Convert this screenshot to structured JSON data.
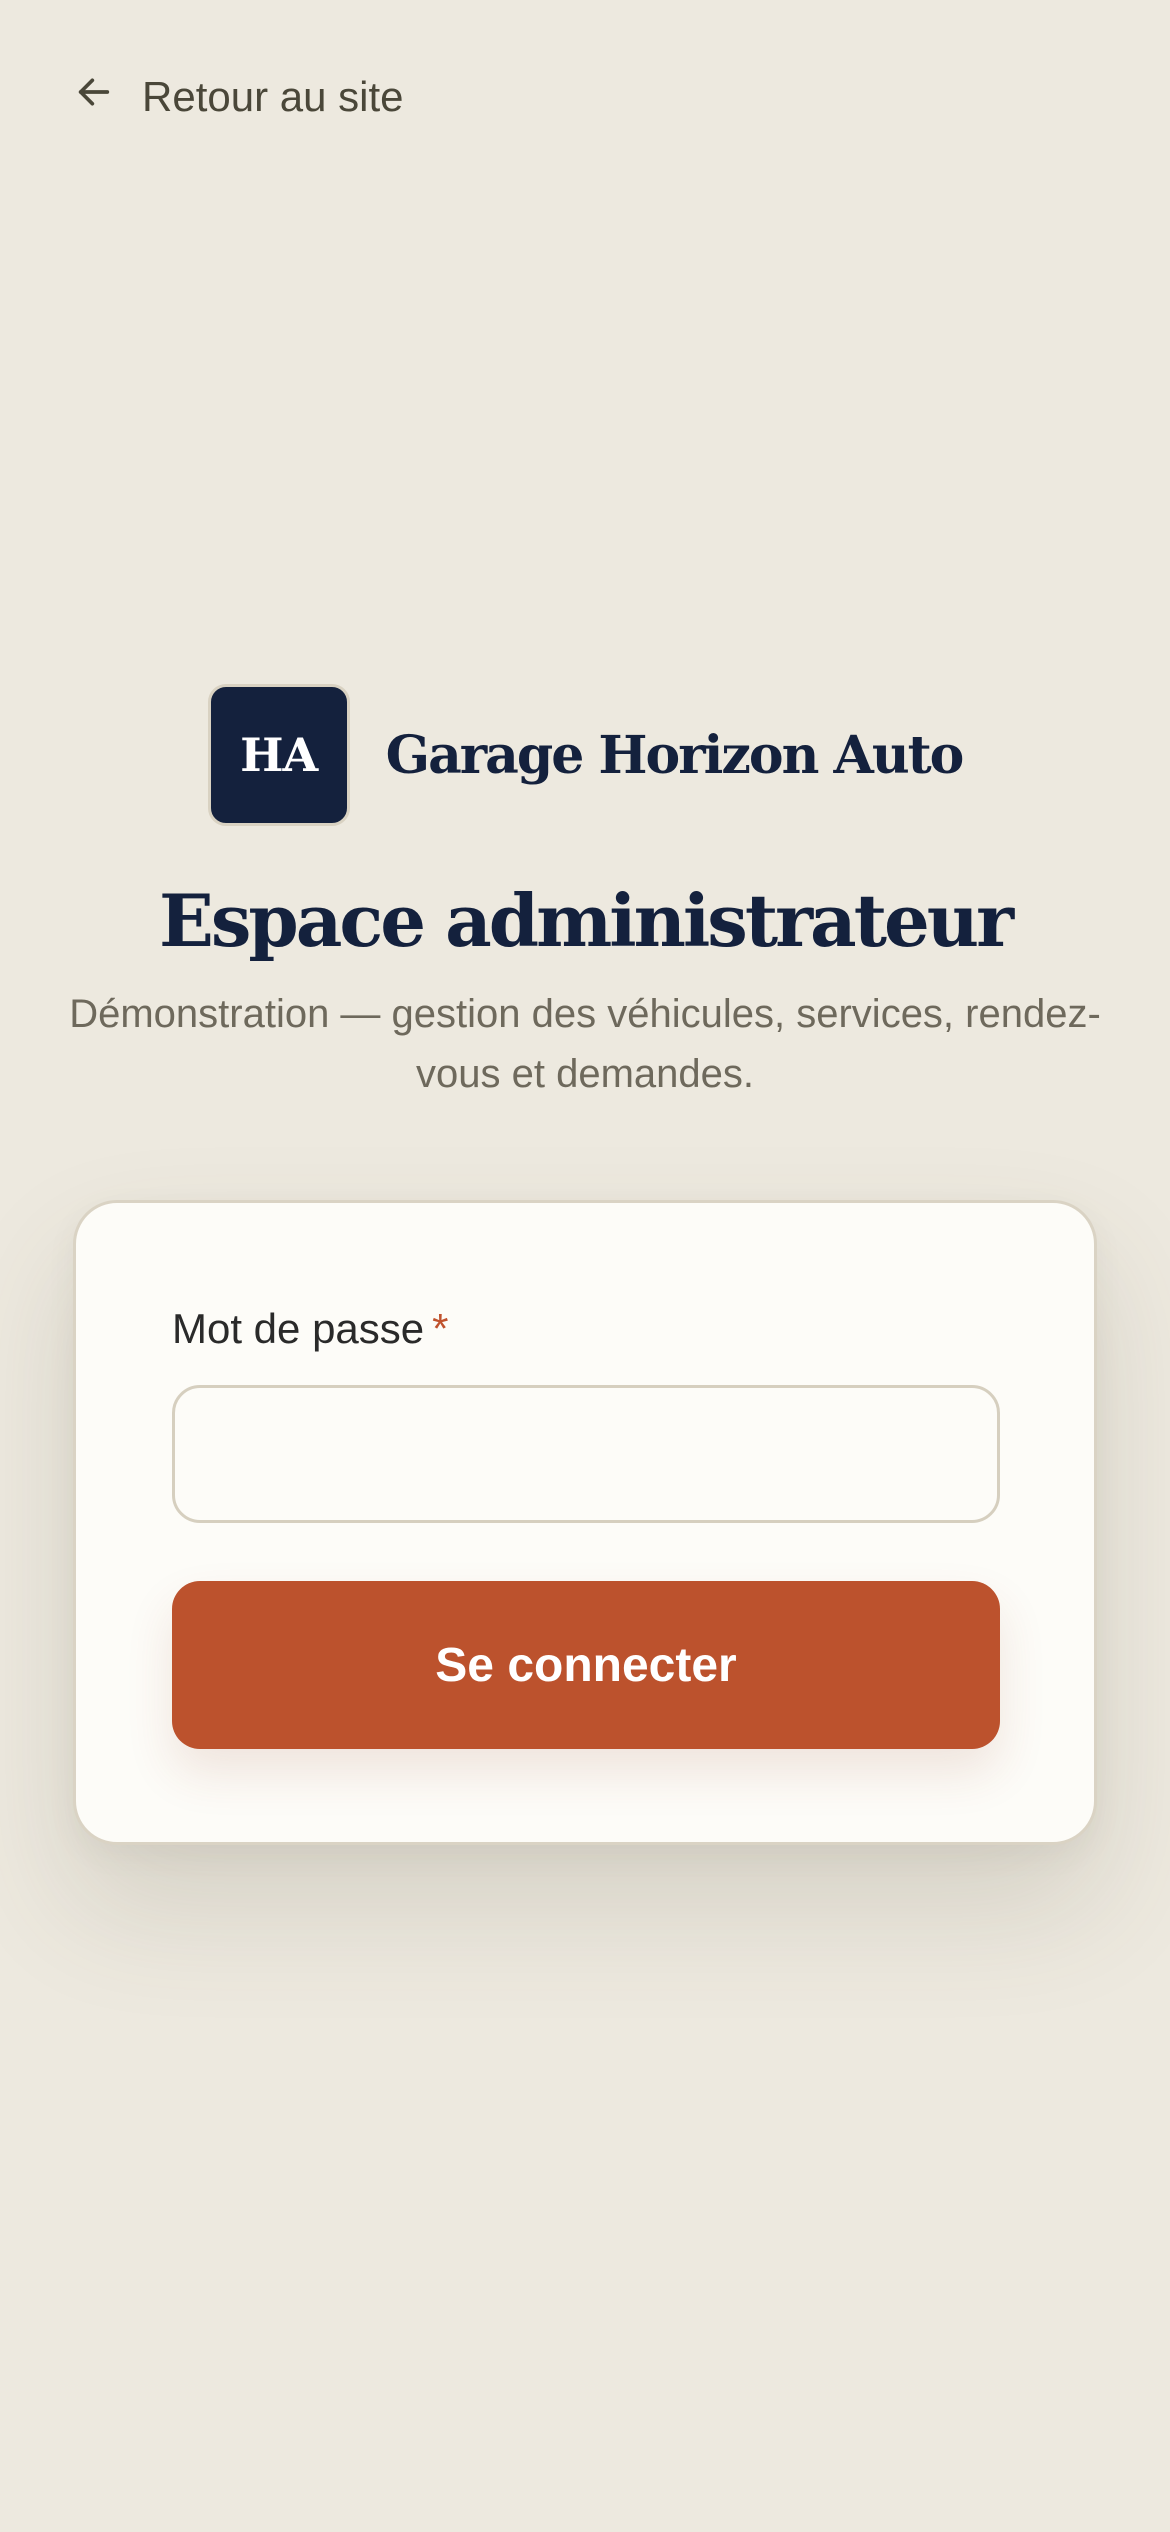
{
  "header": {
    "back_label": "Retour au site",
    "back_icon": "arrow-left-icon"
  },
  "brand": {
    "logo_text": "HA",
    "name": "Garage Horizon Auto"
  },
  "page": {
    "title": "Espace administrateur",
    "subtitle": "Démonstration — gestion des véhicules, services, rendez-vous et demandes."
  },
  "form": {
    "password_label": "Mot de passe",
    "required_mark": "*",
    "password_value": "",
    "submit_label": "Se connecter"
  },
  "colors": {
    "background": "#EDE9DF",
    "navy": "#14213D",
    "accent": "#BC522D",
    "card": "#FDFCF8"
  }
}
